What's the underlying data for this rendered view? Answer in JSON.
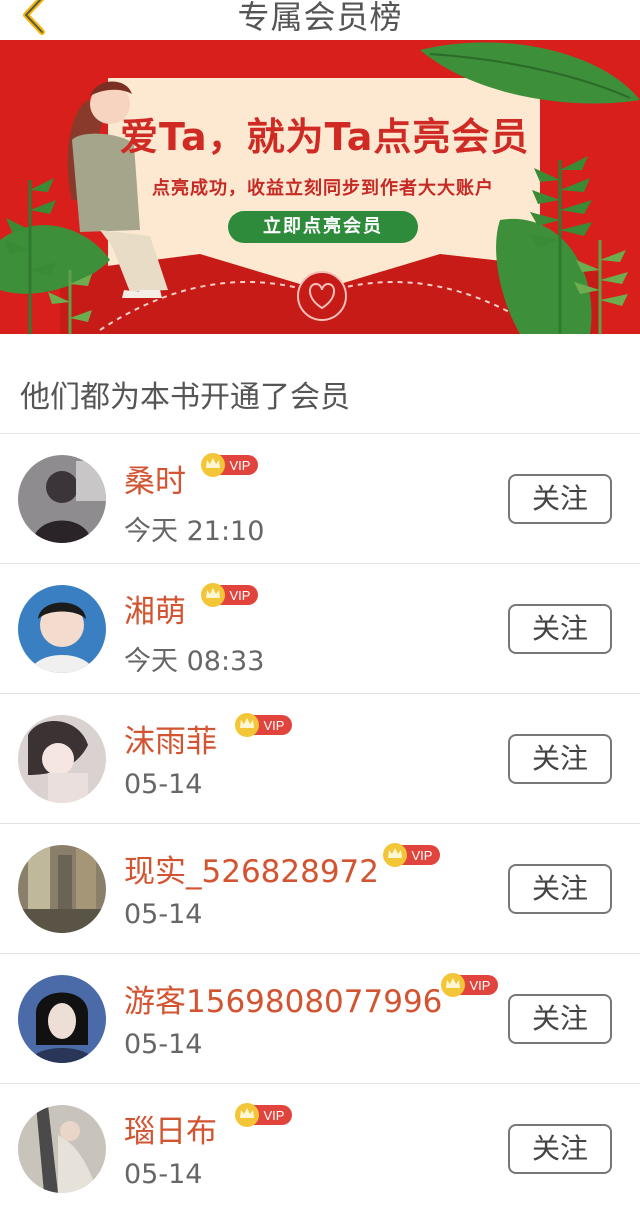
{
  "header": {
    "title": "专属会员榜"
  },
  "banner": {
    "headline": "爱Ta，就为Ta点亮会员",
    "subtitle": "点亮成功，收益立刻同步到作者大大账户",
    "cta_label": "立即点亮会员",
    "colors": {
      "background": "#d81f1b",
      "card": "#fde9d2",
      "cta": "#2e8b3c"
    }
  },
  "section": {
    "title": "他们都为本书开通了会员"
  },
  "members": [
    {
      "name": "桑时",
      "time": "今天 21:10",
      "badge": "VIP",
      "follow_label": "关注"
    },
    {
      "name": "湘萌",
      "time": "今天 08:33",
      "badge": "VIP",
      "follow_label": "关注"
    },
    {
      "name": "沫雨菲",
      "time": "05-14",
      "badge": "VIP",
      "follow_label": "关注"
    },
    {
      "name": "现实_526828972",
      "time": "05-14",
      "badge": "VIP",
      "follow_label": "关注"
    },
    {
      "name": "游客1569808077996",
      "time": "05-14",
      "badge": "VIP",
      "follow_label": "关注"
    },
    {
      "name": "瑙日布",
      "time": "05-14",
      "badge": "VIP",
      "follow_label": "关注"
    }
  ],
  "colors": {
    "name": "#d25431",
    "vip_badge": "#e0443c",
    "crown": "#f1c232"
  }
}
